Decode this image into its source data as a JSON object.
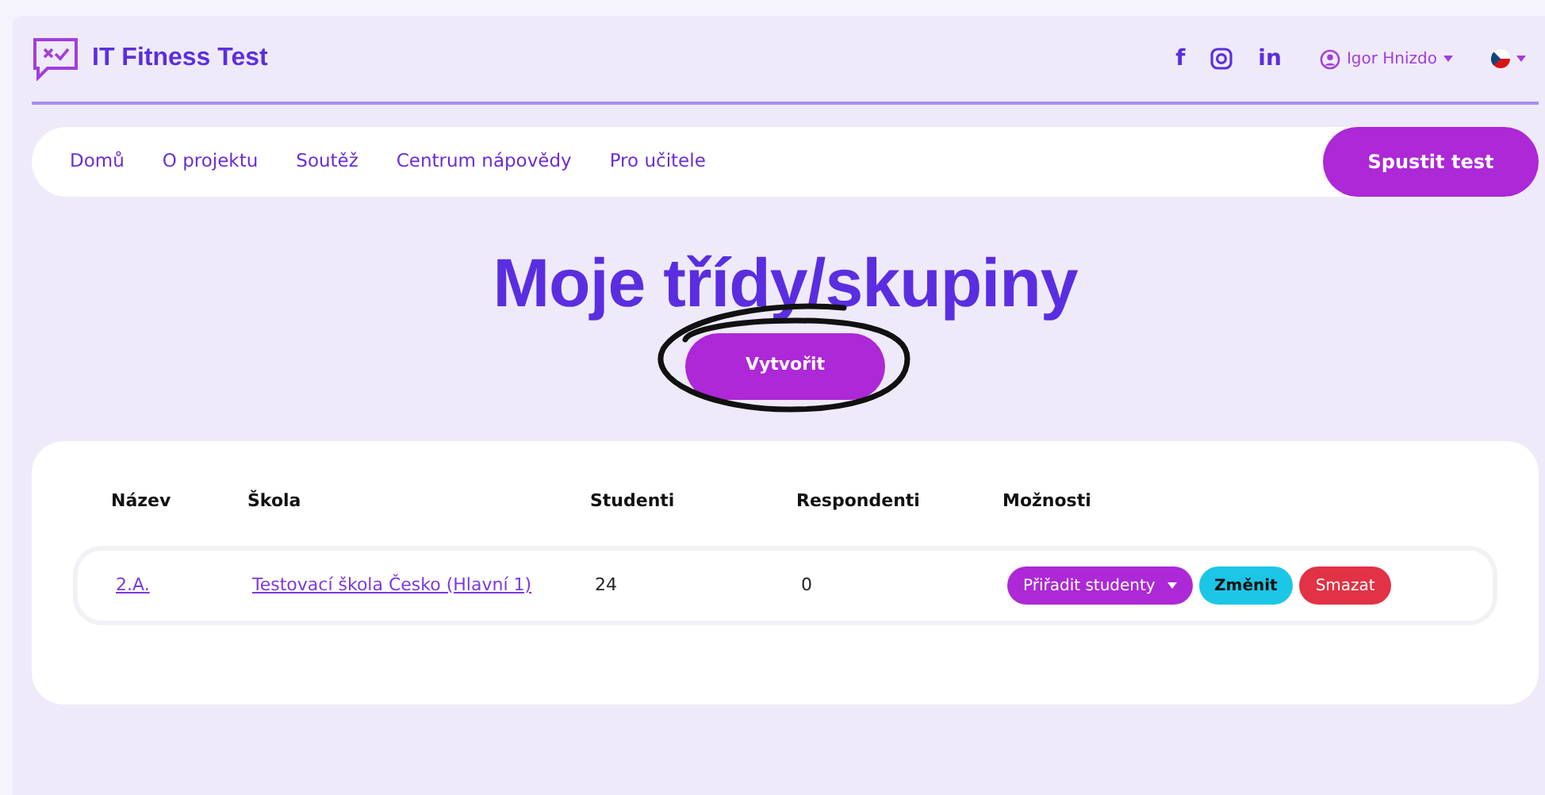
{
  "header": {
    "logo_text": "IT Fitness Test",
    "social": [
      "f",
      "in"
    ],
    "user": "Igor Hnizdo"
  },
  "nav": {
    "items": [
      {
        "label": "Domů"
      },
      {
        "label": "O projektu"
      },
      {
        "label": "Soutěž"
      },
      {
        "label": "Centrum nápovědy"
      },
      {
        "label": "Pro učitele"
      }
    ],
    "cta": "Spustit test"
  },
  "page_title": "Moje třídy/skupiny",
  "create_button": "Vytvořit",
  "table": {
    "columns": [
      "Název",
      "Škola",
      "Studenti",
      "Respondenti",
      "Možnosti"
    ],
    "rows": [
      {
        "name": "2.A.",
        "school": "Testovací škola Česko (Hlavní 1)",
        "students": "24",
        "respondents": "0",
        "actions": [
          {
            "kind": "dropdown",
            "label": "Přiřadit studenty"
          },
          {
            "kind": "edit",
            "label": "Změnit"
          },
          {
            "kind": "delete",
            "label": "Smazat"
          }
        ]
      }
    ]
  }
}
